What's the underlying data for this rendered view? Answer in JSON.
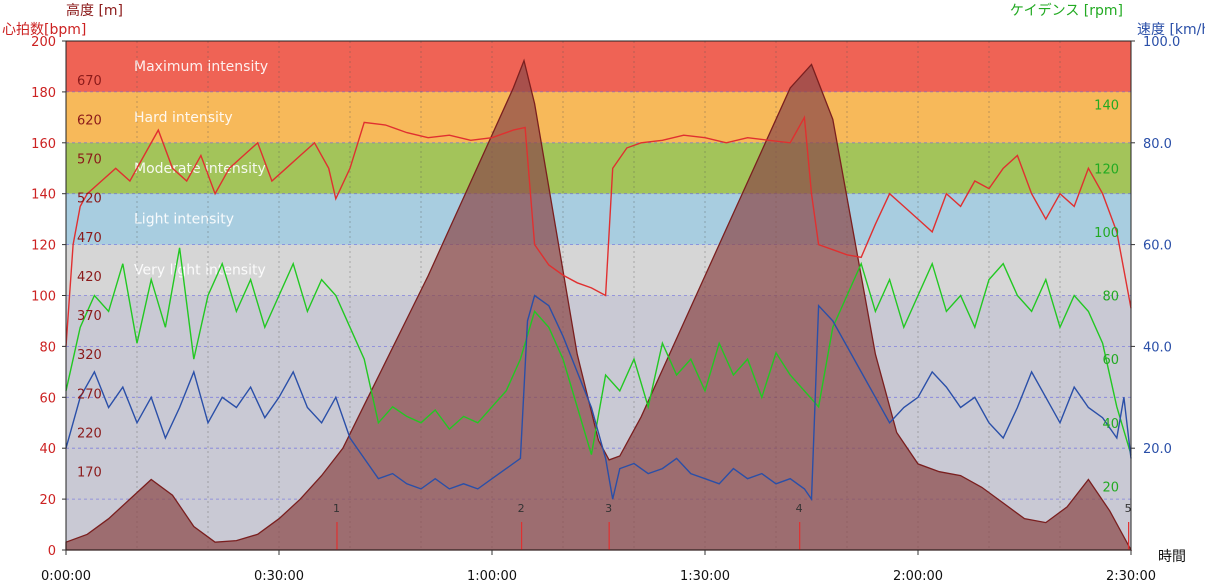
{
  "chart_data": {
    "type": "line",
    "axes": {
      "x": {
        "label": "時間",
        "range_seconds": [
          0,
          9000
        ],
        "ticks": [
          "0:00:00",
          "0:30:00",
          "1:00:00",
          "1:30:00",
          "2:00:00",
          "2:30:00"
        ],
        "tick_values_seconds": [
          0,
          1800,
          3600,
          5400,
          7200,
          9000
        ]
      },
      "heart_rate": {
        "label": "心拍数[bpm]",
        "range": [
          0,
          200
        ],
        "ticks": [
          "0",
          "20",
          "40",
          "60",
          "80",
          "100",
          "120",
          "140",
          "160",
          "180",
          "200"
        ]
      },
      "altitude": {
        "label": "高度 [m]",
        "range": [
          70,
          720
        ],
        "ticks": [
          "170",
          "220",
          "270",
          "320",
          "370",
          "420",
          "470",
          "520",
          "570",
          "620",
          "670"
        ]
      },
      "cadence": {
        "label": "ケイデンス [rpm]",
        "range": [
          0,
          160
        ],
        "ticks": [
          "20",
          "40",
          "60",
          "80",
          "100",
          "120",
          "140"
        ]
      },
      "speed": {
        "label": "速度 [km/h]",
        "range": [
          0,
          100
        ],
        "ticks": [
          "20.0",
          "40.0",
          "60.0",
          "80.0",
          "100.0"
        ]
      }
    },
    "zones": [
      {
        "name": "Maximum intensity",
        "hr_min": 180,
        "hr_max": 200,
        "color": "#ef6355"
      },
      {
        "name": "Hard intensity",
        "hr_min": 160,
        "hr_max": 180,
        "color": "#f7b95a"
      },
      {
        "name": "Moderate intensity",
        "hr_min": 140,
        "hr_max": 160,
        "color": "#a3c45a"
      },
      {
        "name": "Light intensity",
        "hr_min": 120,
        "hr_max": 140,
        "color": "#a8cde0"
      },
      {
        "name": "Very light intensity",
        "hr_min": 100,
        "hr_max": 120,
        "color": "#d6d6d6"
      }
    ],
    "laps": [
      {
        "label": "1",
        "t": 2290
      },
      {
        "label": "2",
        "t": 3850
      },
      {
        "label": "3",
        "t": 4590
      },
      {
        "label": "4",
        "t": 6200
      },
      {
        "label": "5",
        "t": 8980
      }
    ],
    "series": [
      {
        "name": "高度",
        "color": "#9b5f5f",
        "t": [
          0,
          180,
          360,
          540,
          720,
          900,
          1080,
          1260,
          1440,
          1620,
          1800,
          1980,
          2160,
          2340,
          2520,
          2700,
          2880,
          3060,
          3240,
          3420,
          3600,
          3780,
          3870,
          3960,
          4140,
          4320,
          4500,
          4590,
          4680,
          4860,
          5040,
          5220,
          5400,
          5580,
          5760,
          5940,
          6120,
          6300,
          6480,
          6660,
          6840,
          7020,
          7200,
          7380,
          7560,
          7740,
          7920,
          8100,
          8280,
          8460,
          8640,
          8820,
          9000
        ],
        "values": [
          80,
          90,
          110,
          135,
          160,
          140,
          100,
          80,
          82,
          90,
          110,
          135,
          165,
          200,
          255,
          310,
          365,
          420,
          480,
          540,
          600,
          660,
          695,
          640,
          480,
          320,
          210,
          185,
          190,
          240,
          300,
          360,
          420,
          480,
          540,
          600,
          660,
          690,
          620,
          470,
          320,
          220,
          180,
          170,
          165,
          150,
          130,
          110,
          105,
          125,
          160,
          120,
          70
        ]
      },
      {
        "name": "心拍数",
        "color": "#e03030",
        "t": [
          0,
          60,
          120,
          180,
          300,
          420,
          540,
          660,
          780,
          900,
          1020,
          1140,
          1260,
          1380,
          1500,
          1620,
          1740,
          1860,
          1980,
          2100,
          2220,
          2280,
          2400,
          2520,
          2700,
          2880,
          3060,
          3240,
          3420,
          3600,
          3780,
          3880,
          3960,
          4080,
          4200,
          4320,
          4440,
          4560,
          4620,
          4740,
          4860,
          5040,
          5220,
          5400,
          5580,
          5760,
          5940,
          6120,
          6240,
          6300,
          6360,
          6480,
          6600,
          6720,
          6840,
          6960,
          7080,
          7200,
          7320,
          7440,
          7560,
          7680,
          7800,
          7920,
          8040,
          8160,
          8280,
          8400,
          8520,
          8640,
          8760,
          8880,
          8940,
          9000
        ],
        "values": [
          80,
          120,
          135,
          140,
          145,
          150,
          145,
          155,
          165,
          150,
          145,
          155,
          140,
          150,
          155,
          160,
          145,
          150,
          155,
          160,
          150,
          138,
          150,
          168,
          167,
          164,
          162,
          163,
          161,
          162,
          165,
          166,
          120,
          112,
          108,
          105,
          103,
          100,
          150,
          158,
          160,
          161,
          163,
          162,
          160,
          162,
          161,
          160,
          170,
          140,
          120,
          118,
          116,
          115,
          128,
          140,
          135,
          130,
          125,
          140,
          135,
          145,
          142,
          150,
          155,
          140,
          130,
          140,
          135,
          150,
          140,
          125,
          110,
          95
        ]
      },
      {
        "name": "ケイデンス",
        "color": "#22c822",
        "t": [
          0,
          120,
          240,
          360,
          480,
          600,
          720,
          840,
          960,
          1080,
          1200,
          1320,
          1440,
          1560,
          1680,
          1800,
          1920,
          2040,
          2160,
          2280,
          2400,
          2520,
          2640,
          2760,
          2880,
          3000,
          3120,
          3240,
          3360,
          3480,
          3600,
          3720,
          3840,
          3960,
          4080,
          4200,
          4320,
          4440,
          4560,
          4680,
          4800,
          4920,
          5040,
          5160,
          5280,
          5400,
          5520,
          5640,
          5760,
          5880,
          6000,
          6120,
          6240,
          6360,
          6480,
          6600,
          6720,
          6840,
          6960,
          7080,
          7200,
          7320,
          7440,
          7560,
          7680,
          7800,
          7920,
          8040,
          8160,
          8280,
          8400,
          8520,
          8640,
          8760,
          8880,
          9000
        ],
        "values": [
          50,
          70,
          80,
          75,
          90,
          65,
          85,
          70,
          95,
          60,
          80,
          90,
          75,
          85,
          70,
          80,
          90,
          75,
          85,
          80,
          70,
          60,
          40,
          45,
          42,
          40,
          44,
          38,
          42,
          40,
          45,
          50,
          60,
          75,
          70,
          60,
          45,
          30,
          55,
          50,
          60,
          45,
          65,
          55,
          60,
          50,
          65,
          55,
          60,
          48,
          62,
          55,
          50,
          45,
          70,
          80,
          90,
          75,
          85,
          70,
          80,
          90,
          75,
          80,
          70,
          85,
          90,
          80,
          75,
          85,
          70,
          80,
          75,
          65,
          45,
          30
        ]
      },
      {
        "name": "速度",
        "color": "#2a4fa8",
        "t": [
          0,
          120,
          240,
          360,
          480,
          600,
          720,
          840,
          960,
          1080,
          1200,
          1320,
          1440,
          1560,
          1680,
          1800,
          1920,
          2040,
          2160,
          2280,
          2400,
          2520,
          2640,
          2760,
          2880,
          3000,
          3120,
          3240,
          3360,
          3480,
          3600,
          3720,
          3840,
          3900,
          3960,
          4080,
          4200,
          4320,
          4440,
          4560,
          4620,
          4680,
          4800,
          4920,
          5040,
          5160,
          5280,
          5400,
          5520,
          5640,
          5760,
          5880,
          6000,
          6120,
          6240,
          6300,
          6360,
          6480,
          6600,
          6720,
          6840,
          6960,
          7080,
          7200,
          7320,
          7440,
          7560,
          7680,
          7800,
          7920,
          8040,
          8160,
          8280,
          8400,
          8520,
          8640,
          8760,
          8880,
          8940,
          9000
        ],
        "values": [
          20,
          30,
          35,
          28,
          32,
          25,
          30,
          22,
          28,
          35,
          25,
          30,
          28,
          32,
          26,
          30,
          35,
          28,
          25,
          30,
          22,
          18,
          14,
          15,
          13,
          12,
          14,
          12,
          13,
          12,
          14,
          16,
          18,
          45,
          50,
          48,
          42,
          35,
          28,
          18,
          10,
          16,
          17,
          15,
          16,
          18,
          15,
          14,
          13,
          16,
          14,
          15,
          13,
          14,
          12,
          10,
          48,
          45,
          40,
          35,
          30,
          25,
          28,
          30,
          35,
          32,
          28,
          30,
          25,
          22,
          28,
          35,
          30,
          25,
          32,
          28,
          26,
          22,
          30,
          18
        ]
      }
    ]
  }
}
